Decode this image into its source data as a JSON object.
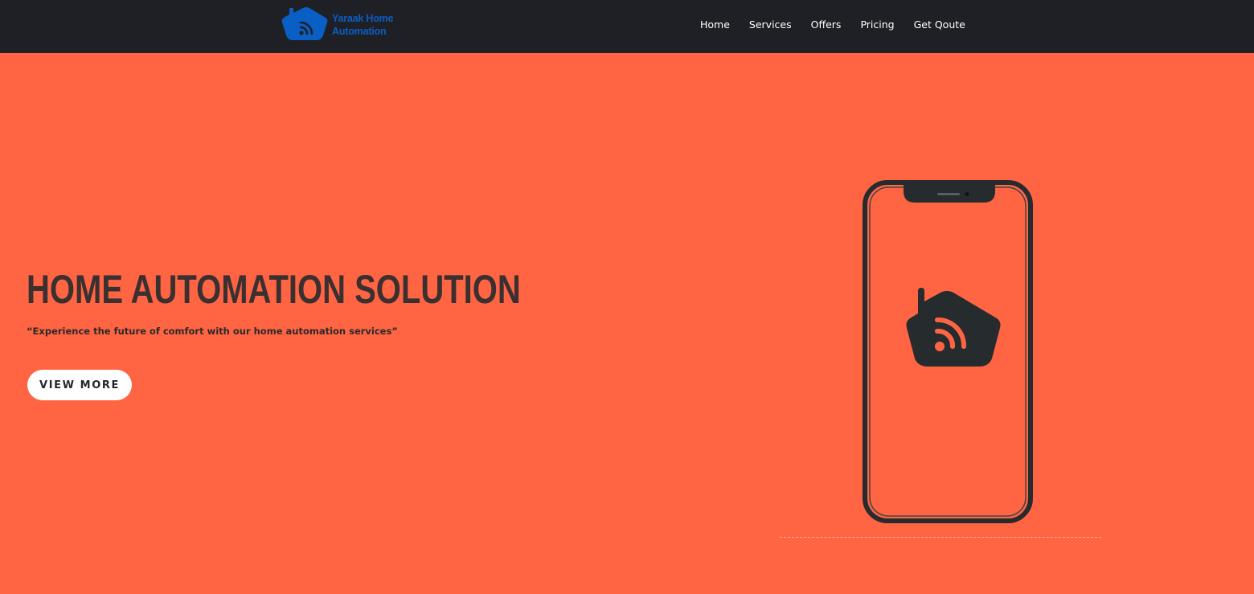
{
  "header": {
    "logo_text": "Yaraak Home Automation",
    "nav": [
      "Home",
      "Services",
      "Offers",
      "Pricing",
      "Get Qoute"
    ]
  },
  "hero": {
    "title": "HOME AUTOMATION SOLUTION",
    "subtitle": "“Experience the future of comfort with our home automation services”",
    "button_label": "VIEW MORE"
  },
  "icons": {
    "logo": "house-wifi-icon",
    "phone": "smartphone-icon",
    "phone_screen": "house-wifi-icon"
  },
  "colors": {
    "hero_background": "#FF6443",
    "header_background": "#1F1F26",
    "logo_blue": "#0A5FC4",
    "dark": "#2A2F33",
    "button_background": "#FFFFFF"
  }
}
